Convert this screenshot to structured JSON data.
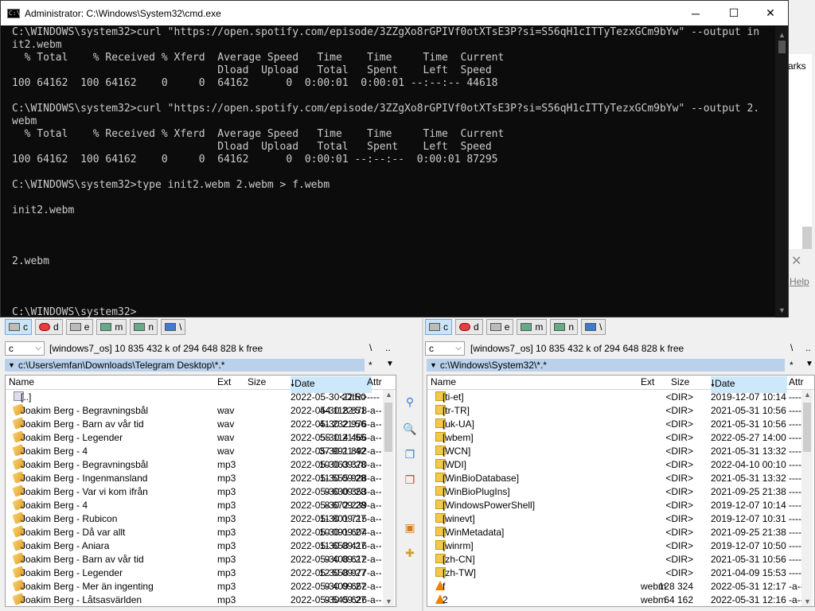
{
  "background": {
    "right_edge_text": "arks",
    "help_text": "Help",
    "close_glyph": "✕"
  },
  "cmd": {
    "title": "Administrator: C:\\Windows\\System32\\cmd.exe",
    "icon_text": "C:\\",
    "buttons": {
      "minimize": "─",
      "maximize": "☐",
      "close": "✕"
    },
    "lines": [
      "C:\\WINDOWS\\system32>curl \"https://open.spotify.com/episode/3ZZgXo8rGPIVf0otXTsE3P?si=S56qH1cITTyTezxGCm9bYw\" --output in",
      "it2.webm",
      "  % Total    % Received % Xferd  Average Speed   Time    Time     Time  Current",
      "                                 Dload  Upload   Total   Spent    Left  Speed",
      "100 64162  100 64162    0     0  64162      0  0:00:01  0:00:01 --:--:-- 44618",
      "",
      "C:\\WINDOWS\\system32>curl \"https://open.spotify.com/episode/3ZZgXo8rGPIVf0otXTsE3P?si=S56qH1cITTyTezxGCm9bYw\" --output 2.",
      "webm",
      "  % Total    % Received % Xferd  Average Speed   Time    Time     Time  Current",
      "                                 Dload  Upload   Total   Spent    Left  Speed",
      "100 64162  100 64162    0     0  64162      0  0:00:01 --:--:--  0:00:01 87295",
      "",
      "C:\\WINDOWS\\system32>type init2.webm 2.webm > f.webm",
      "",
      "init2.webm",
      "",
      "",
      "",
      "2.webm",
      "",
      "",
      "",
      "C:\\WINDOWS\\system32>"
    ]
  },
  "drives": [
    "c",
    "d",
    "e",
    "m",
    "n",
    "\\"
  ],
  "left": {
    "drive": "c",
    "label_free": "[windows7_os]  10 835 432 k of 294 648 828 k free",
    "root_sym": "\\",
    "up_sym": "..",
    "path": "c:\\Users\\emfan\\Downloads\\Telegram Desktop\\*.*",
    "filter_sym": "*",
    "dropdown_sym": "▼",
    "columns": {
      "name": "Name",
      "ext": "Ext",
      "size": "Size",
      "date": "Date",
      "attr": "Attr"
    },
    "rows": [
      {
        "icon": "up",
        "name": "[..]",
        "ext": "",
        "size": "<DIR>",
        "date": "2022-05-30 22:50",
        "attr": "----"
      },
      {
        "icon": "wav",
        "name": "Joakim Berg - Begravningsbål",
        "ext": "wav",
        "size": "44 118 878",
        "date": "2022-05-30 22:51",
        "attr": "-a--"
      },
      {
        "icon": "wav",
        "name": "Joakim Berg - Barn av vår tid",
        "ext": "wav",
        "size": "41 232 976",
        "date": "2022-05-30 21:56",
        "attr": "-a--"
      },
      {
        "icon": "wav",
        "name": "Joakim Berg - Legender",
        "ext": "wav",
        "size": "55 114 466",
        "date": "2022-05-30 21:55",
        "attr": "-a--"
      },
      {
        "icon": "wav",
        "name": "Joakim Berg - 4",
        "ext": "wav",
        "size": "37 991 892",
        "date": "2022-05-30 21:42",
        "attr": "-a--"
      },
      {
        "icon": "mp3",
        "name": "Joakim Berg - Begravningsbål",
        "ext": "mp3",
        "size": "10 063 370",
        "date": "2022-05-30 09:28",
        "attr": "-a--"
      },
      {
        "icon": "mp3",
        "name": "Joakim Berg - Ingenmansland",
        "ext": "mp3",
        "size": "11 555 928",
        "date": "2022-05-30 09:28",
        "attr": "-a--"
      },
      {
        "icon": "mp3",
        "name": "Joakim Berg - Var vi kom ifrån",
        "ext": "mp3",
        "size": "9 630 353",
        "date": "2022-05-30 09:28",
        "attr": "-a--"
      },
      {
        "icon": "mp3",
        "name": "Joakim Berg - 4",
        "ext": "mp3",
        "size": "8 672 239",
        "date": "2022-05-30 09:28",
        "attr": "-a--"
      },
      {
        "icon": "mp3",
        "name": "Joakim Berg - Rubicon",
        "ext": "mp3",
        "size": "11 801 715",
        "date": "2022-05-30 09:27",
        "attr": "-a--"
      },
      {
        "icon": "mp3",
        "name": "Joakim Berg - Då var allt",
        "ext": "mp3",
        "size": "10 091 604",
        "date": "2022-05-30 09:27",
        "attr": "-a--"
      },
      {
        "icon": "mp3",
        "name": "Joakim Berg - Aniara",
        "ext": "mp3",
        "size": "11 658 416",
        "date": "2022-05-30 09:27",
        "attr": "-a--"
      },
      {
        "icon": "mp3",
        "name": "Joakim Berg - Barn av vår tid",
        "ext": "mp3",
        "size": "9 408 612",
        "date": "2022-05-30 09:27",
        "attr": "-a--"
      },
      {
        "icon": "mp3",
        "name": "Joakim Berg - Legender",
        "ext": "mp3",
        "size": "12 558 977",
        "date": "2022-05-30 09:27",
        "attr": "-a--"
      },
      {
        "icon": "mp3",
        "name": "Joakim Berg - Mer än ingenting",
        "ext": "mp3",
        "size": "9 409 662",
        "date": "2022-05-30 09:27",
        "attr": "-a--"
      },
      {
        "icon": "mp3",
        "name": "Joakim Berg - Låtsasvärlden",
        "ext": "mp3",
        "size": "9 545 626",
        "date": "2022-05-30 09:27",
        "attr": "-a--"
      }
    ]
  },
  "right": {
    "drive": "c",
    "label_free": "[windows7_os]  10 835 432 k of 294 648 828 k free",
    "root_sym": "\\",
    "up_sym": "..",
    "path": "c:\\Windows\\System32\\*.*",
    "filter_sym": "*",
    "dropdown_sym": "▼",
    "columns": {
      "name": "Name",
      "ext": "Ext",
      "size": "Size",
      "date": "Date",
      "attr": "Attr"
    },
    "rows": [
      {
        "icon": "dir",
        "name": "[ti-et]",
        "ext": "",
        "size": "<DIR>",
        "date": "2019-12-07 10:14",
        "attr": "----"
      },
      {
        "icon": "dir",
        "name": "[tr-TR]",
        "ext": "",
        "size": "<DIR>",
        "date": "2021-05-31 10:56",
        "attr": "----"
      },
      {
        "icon": "dir",
        "name": "[uk-UA]",
        "ext": "",
        "size": "<DIR>",
        "date": "2021-05-31 10:56",
        "attr": "----"
      },
      {
        "icon": "dir",
        "name": "[wbem]",
        "ext": "",
        "size": "<DIR>",
        "date": "2022-05-27 14:00",
        "attr": "----"
      },
      {
        "icon": "dir",
        "name": "[WCN]",
        "ext": "",
        "size": "<DIR>",
        "date": "2021-05-31 13:32",
        "attr": "----"
      },
      {
        "icon": "dir",
        "name": "[WDI]",
        "ext": "",
        "size": "<DIR>",
        "date": "2022-04-10 00:10",
        "attr": "----"
      },
      {
        "icon": "dir",
        "name": "[WinBioDatabase]",
        "ext": "",
        "size": "<DIR>",
        "date": "2021-05-31 13:32",
        "attr": "----"
      },
      {
        "icon": "dir",
        "name": "[WinBioPlugIns]",
        "ext": "",
        "size": "<DIR>",
        "date": "2021-09-25 21:38",
        "attr": "----"
      },
      {
        "icon": "dir",
        "name": "[WindowsPowerShell]",
        "ext": "",
        "size": "<DIR>",
        "date": "2019-12-07 10:14",
        "attr": "----"
      },
      {
        "icon": "dir",
        "name": "[winevt]",
        "ext": "",
        "size": "<DIR>",
        "date": "2019-12-07 10:31",
        "attr": "----"
      },
      {
        "icon": "dir",
        "name": "[WinMetadata]",
        "ext": "",
        "size": "<DIR>",
        "date": "2021-09-25 21:38",
        "attr": "----"
      },
      {
        "icon": "dir",
        "name": "[winrm]",
        "ext": "",
        "size": "<DIR>",
        "date": "2019-12-07 10:50",
        "attr": "----"
      },
      {
        "icon": "dir",
        "name": "[zh-CN]",
        "ext": "",
        "size": "<DIR>",
        "date": "2021-05-31 10:56",
        "attr": "----"
      },
      {
        "icon": "dir",
        "name": "[zh-TW]",
        "ext": "",
        "size": "<DIR>",
        "date": "2021-04-09 15:53",
        "attr": "----"
      },
      {
        "icon": "vlc",
        "name": "f",
        "ext": "webm",
        "size": "128 324",
        "date": "2022-05-31 12:17",
        "attr": "-a--"
      },
      {
        "icon": "vlc",
        "name": "2",
        "ext": "webm",
        "size": "64 162",
        "date": "2022-05-31 12:16",
        "attr": "-a--"
      }
    ]
  },
  "middle_toolbar": {
    "icons": [
      "compare-icon",
      "search-file-icon",
      "copy-icon",
      "delete-icon",
      "gift-icon",
      "new-folder-icon"
    ],
    "glyphs": [
      "⚲",
      "🔍",
      "❐",
      "❐",
      "▣",
      "✚"
    ]
  },
  "colors": {
    "cmd_bg": "#0c0c0c",
    "cmd_text": "#cccccc",
    "path_bar": "#b9d1ea",
    "sorted_col": "#cde8fb"
  }
}
